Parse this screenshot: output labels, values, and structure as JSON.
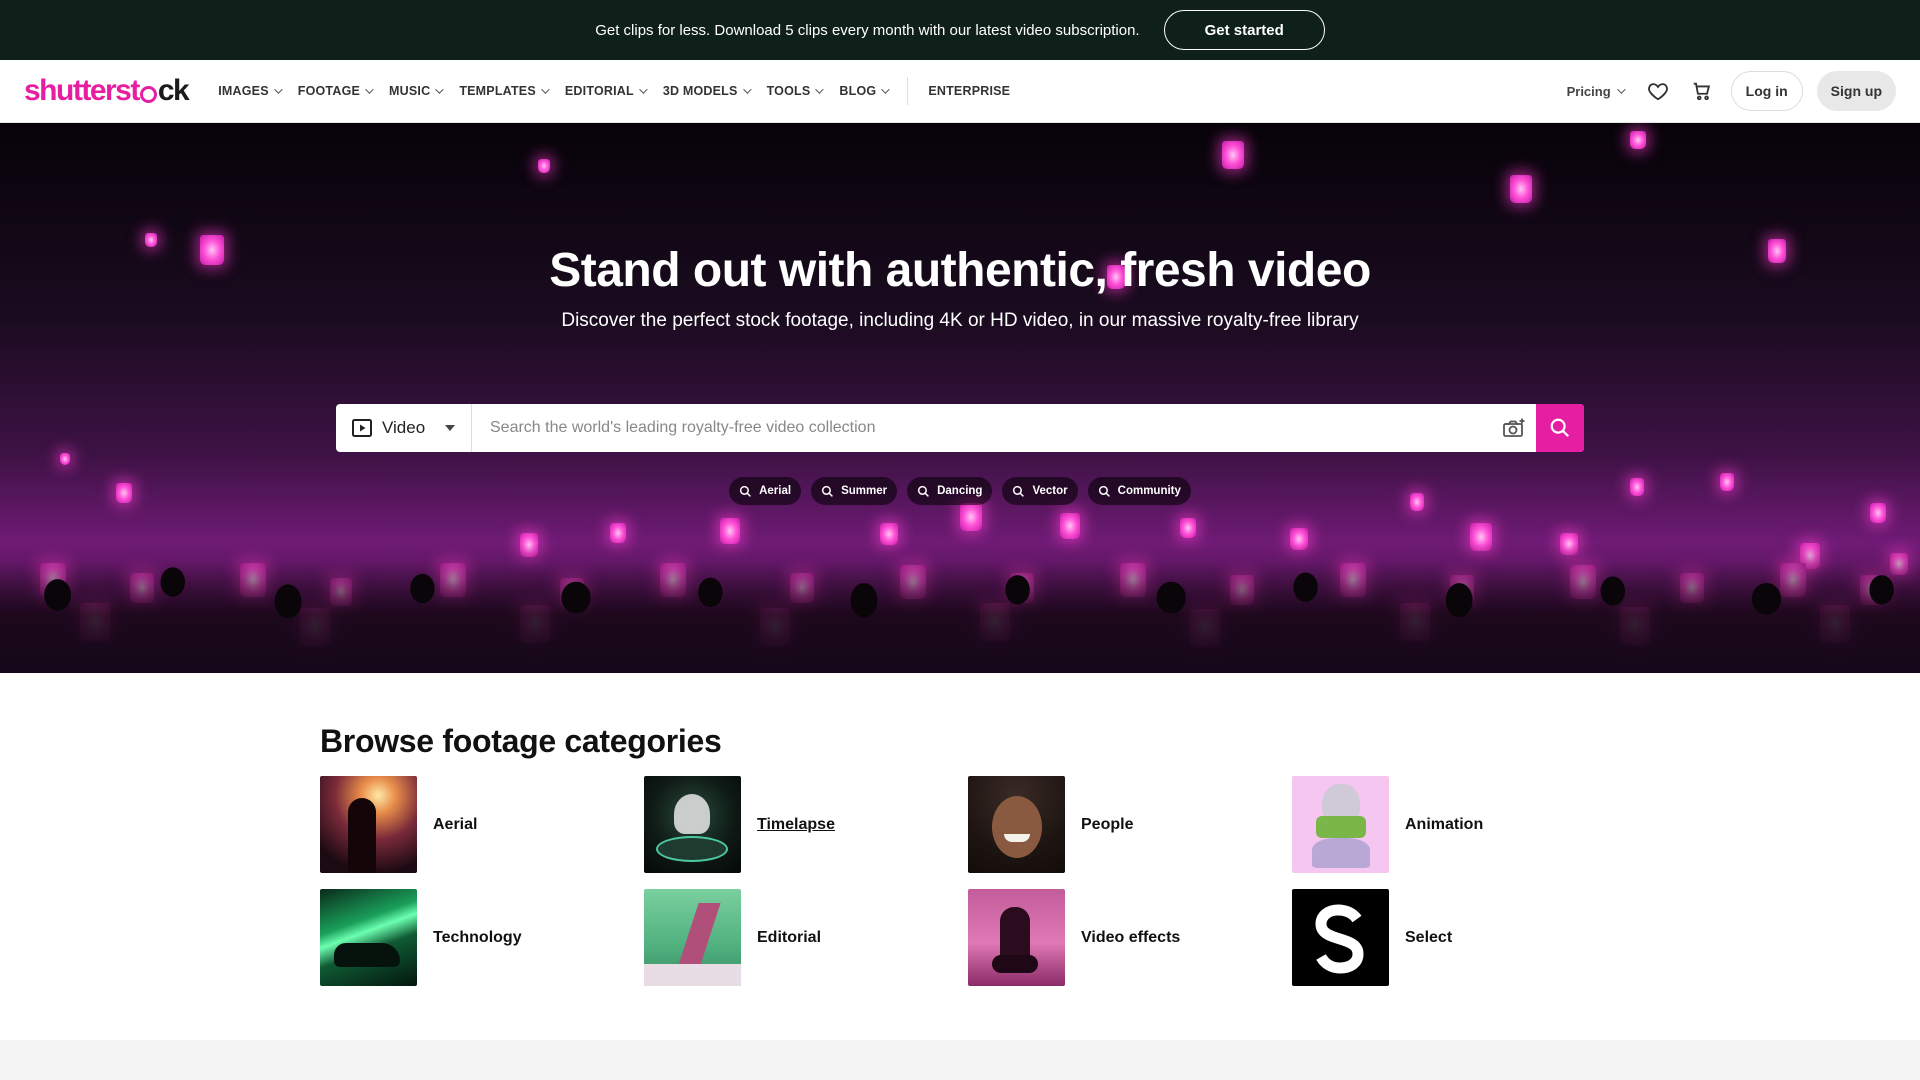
{
  "promo": {
    "text": "Get clips for less. Download 5 clips every month with our latest video subscription.",
    "cta": "Get started"
  },
  "nav": {
    "logo": {
      "part1": "shutterst",
      "part2": "ck"
    },
    "items": [
      {
        "label": "IMAGES",
        "dropdown": true
      },
      {
        "label": "FOOTAGE",
        "dropdown": true
      },
      {
        "label": "MUSIC",
        "dropdown": true
      },
      {
        "label": "TEMPLATES",
        "dropdown": true
      },
      {
        "label": "EDITORIAL",
        "dropdown": true
      },
      {
        "label": "3D MODELS",
        "dropdown": true
      },
      {
        "label": "TOOLS",
        "dropdown": true
      },
      {
        "label": "BLOG",
        "dropdown": true
      }
    ],
    "enterprise": "ENTERPRISE",
    "pricing": "Pricing",
    "login": "Log in",
    "signup": "Sign up"
  },
  "hero": {
    "title": "Stand out with authentic, fresh video",
    "subtitle": "Discover the perfect stock footage, including 4K or HD video, in our massive royalty-free library",
    "search": {
      "type": "Video",
      "placeholder": "Search the world's leading royalty-free video collection"
    },
    "chips": [
      "Aerial",
      "Summer",
      "Dancing",
      "Vector",
      "Community"
    ]
  },
  "browse": {
    "title": "Browse footage categories",
    "categories": [
      {
        "label": "Aerial",
        "thumb": "concert-singer"
      },
      {
        "label": "Timelapse",
        "thumb": "drummer"
      },
      {
        "label": "People",
        "thumb": "smiling-woman"
      },
      {
        "label": "Animation",
        "thumb": "statue-bust"
      },
      {
        "label": "Technology",
        "thumb": "laser-car"
      },
      {
        "label": "Editorial",
        "thumb": "lighthouse"
      },
      {
        "label": "Video effects",
        "thumb": "motorbike-rider"
      },
      {
        "label": "Select",
        "thumb": "select-s-logo"
      }
    ]
  },
  "colors": {
    "brand": "#e61ea2",
    "promo_bg": "#0f1f1a"
  }
}
